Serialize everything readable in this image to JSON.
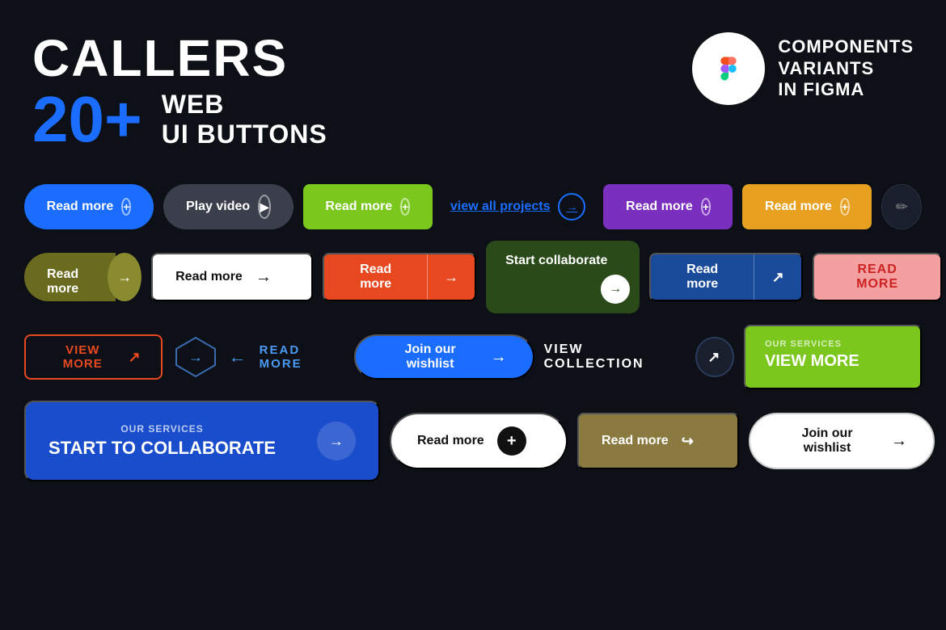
{
  "header": {
    "title_callers": "CALLERS",
    "title_number": "20+",
    "title_web": "WEB",
    "title_buttons": "UI BUTTONS",
    "figma_label1": "COMPONENTS",
    "figma_label2": "VARIANTS",
    "figma_label3": "IN FIGMA"
  },
  "rows": {
    "row1": {
      "btn1": {
        "label": "Read more",
        "icon": "+"
      },
      "btn2": {
        "label": "Play video"
      },
      "btn3": {
        "label": "Read more",
        "icon": "+"
      },
      "btn4": {
        "label": "view all projects"
      },
      "btn5": {
        "label": "Read more",
        "icon": "+"
      },
      "btn6": {
        "label": "Read more",
        "icon": "+"
      }
    },
    "row2": {
      "btn1": {
        "label": "Read more"
      },
      "btn2": {
        "label": "Read more"
      },
      "btn3": {
        "label": "Read more"
      },
      "btn4": {
        "label": "Start collaborate"
      },
      "btn5": {
        "label": "Read more"
      },
      "btn6": {
        "label": "READ MORE"
      }
    },
    "row3": {
      "btn1": {
        "label": "VIEW MORE"
      },
      "btn2": {
        "label": "READ MORE"
      },
      "btn3": {
        "label": "Join our wishlist"
      },
      "btn4": {
        "label": "VIEW COLLECTION"
      },
      "btn5": {
        "sub": "OUR SERVICES",
        "label": "VIEW MORE"
      }
    },
    "row4": {
      "btn1": {
        "sub": "OUR SERVICES",
        "label": "START TO COLLABORATE"
      },
      "btn2": {
        "label": "Read more"
      },
      "btn3": {
        "label": "Read more"
      },
      "btn4": {
        "label": "Join our wishlist"
      }
    }
  }
}
